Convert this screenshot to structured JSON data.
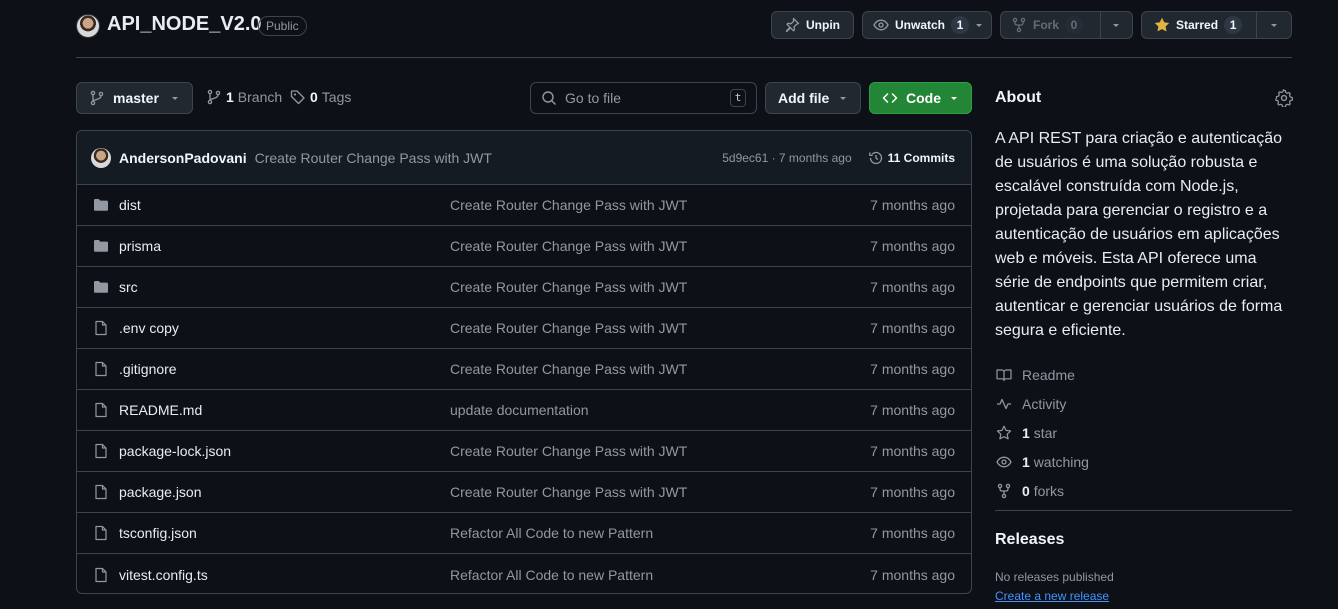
{
  "repo": {
    "name": "API_NODE_V2.0",
    "visibility": "Public"
  },
  "actions": {
    "unpin": "Unpin",
    "unwatch": "Unwatch",
    "watch_count": "1",
    "fork": "Fork",
    "fork_count": "0",
    "starred": "Starred",
    "star_count": "1"
  },
  "toolbar": {
    "branch": "master",
    "branches_count": "1",
    "branches_label": "Branch",
    "tags_count": "0",
    "tags_label": "Tags",
    "search_placeholder": "Go to file",
    "search_kbd": "t",
    "add_file": "Add file",
    "code": "Code"
  },
  "latest_commit": {
    "author": "AndersonPadovani",
    "message": "Create Router Change Pass with JWT",
    "meta": "5d9ec61 · 7 months ago",
    "commits": "11 Commits"
  },
  "files": [
    {
      "type": "folder",
      "name": "dist",
      "message": "Create Router Change Pass with JWT",
      "date": "7 months ago"
    },
    {
      "type": "folder",
      "name": "prisma",
      "message": "Create Router Change Pass with JWT",
      "date": "7 months ago"
    },
    {
      "type": "folder",
      "name": "src",
      "message": "Create Router Change Pass with JWT",
      "date": "7 months ago"
    },
    {
      "type": "file",
      "name": ".env copy",
      "message": "Create Router Change Pass with JWT",
      "date": "7 months ago"
    },
    {
      "type": "file",
      "name": ".gitignore",
      "message": "Create Router Change Pass with JWT",
      "date": "7 months ago"
    },
    {
      "type": "file",
      "name": "README.md",
      "message": "update documentation",
      "date": "7 months ago"
    },
    {
      "type": "file",
      "name": "package-lock.json",
      "message": "Create Router Change Pass with JWT",
      "date": "7 months ago"
    },
    {
      "type": "file",
      "name": "package.json",
      "message": "Create Router Change Pass with JWT",
      "date": "7 months ago"
    },
    {
      "type": "file",
      "name": "tsconfig.json",
      "message": "Refactor All Code to new Pattern",
      "date": "7 months ago"
    },
    {
      "type": "file",
      "name": "vitest.config.ts",
      "message": "Refactor All Code to new Pattern",
      "date": "7 months ago"
    }
  ],
  "about": {
    "title": "About",
    "description": "A API REST para criação e autenticação de usuários é uma solução robusta e escalável construída com Node.js, projetada para gerenciar o registro e a autenticação de usuários em aplicações web e móveis. Esta API oferece uma série de endpoints que permitem criar, autenticar e gerenciar usuários de forma segura e eficiente.",
    "readme": "Readme",
    "activity": "Activity",
    "stars_count": "1",
    "stars_label": "star",
    "watching_count": "1",
    "watching_label": "watching",
    "forks_count": "0",
    "forks_label": "forks"
  },
  "releases": {
    "title": "Releases",
    "none": "No releases published",
    "create": "Create a new release"
  },
  "colors": {
    "background": "#0d1117",
    "border": "#3d444d",
    "code_button": "#238636",
    "link": "#4493f8",
    "star": "#e3b341"
  }
}
